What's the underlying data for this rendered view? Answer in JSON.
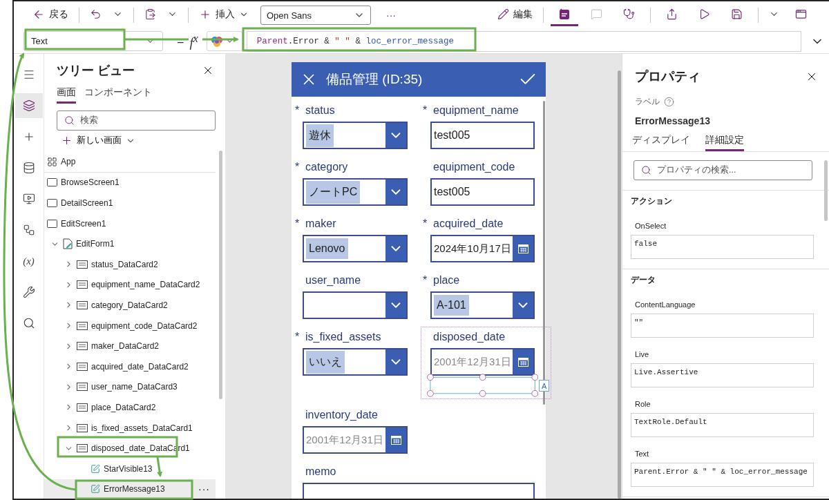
{
  "toolbar": {
    "back": {
      "label": "戻る"
    },
    "history": [
      {
        "kind": "undo"
      },
      {
        "kind": "paste"
      }
    ],
    "insert": {
      "label": "挿入"
    },
    "font": {
      "value": "Open Sans"
    },
    "more": "···",
    "edit": {
      "label": "編集"
    },
    "tools": [
      {
        "kind": "app-checker",
        "selected": true,
        "disabled": false
      },
      {
        "kind": "comment",
        "selected": false,
        "disabled": true
      },
      {
        "kind": "monitor",
        "selected": false,
        "disabled": false
      },
      {
        "kind": "share",
        "selected": false,
        "disabled": false
      },
      {
        "kind": "play",
        "selected": false,
        "disabled": false
      },
      {
        "kind": "save",
        "selected": false,
        "disabled": false
      },
      {
        "kind": "publish",
        "selected": false,
        "disabled": false
      }
    ]
  },
  "formula_bar": {
    "property": "Text",
    "equals": "=",
    "function_label": "f$^{x}$",
    "tokens": [
      {
        "text": "Parent",
        "kind": "keyword"
      },
      {
        "text": ".Error & ",
        "kind": "plain"
      },
      {
        "text": "\" \"",
        "kind": "string"
      },
      {
        "text": " & ",
        "kind": "plain"
      },
      {
        "text": "loc_error_message",
        "kind": "variable"
      }
    ]
  },
  "rail": [
    {
      "kind": "menu",
      "selected": false
    },
    {
      "kind": "tree",
      "selected": true
    },
    {
      "kind": "insert",
      "selected": false
    },
    {
      "kind": "data",
      "selected": false
    },
    {
      "kind": "media",
      "selected": false
    },
    {
      "kind": "automate",
      "selected": false
    },
    {
      "kind": "variables",
      "selected": false,
      "label": "(x)"
    },
    {
      "kind": "tools",
      "selected": false
    },
    {
      "kind": "search",
      "selected": false
    }
  ],
  "tree_view": {
    "title": "ツリー ビュー",
    "tabs": [
      {
        "label": "画面",
        "selected": true
      },
      {
        "label": "コンポーネント",
        "selected": false
      }
    ],
    "search": {
      "placeholder": "検索"
    },
    "new_screen": {
      "label": "新しい画面"
    },
    "items": [
      {
        "label": "App",
        "kind": "app",
        "selected": false
      },
      {
        "label": "BrowseScreen1",
        "kind": "screen",
        "selected": false
      },
      {
        "label": "DetailScreen1",
        "kind": "screen",
        "selected": false
      },
      {
        "label": "EditScreen1",
        "kind": "screen",
        "selected": false,
        "children": [
          {
            "label": "EditForm1",
            "kind": "form",
            "selected": false,
            "expanded": true,
            "children": [
              {
                "label": "status_DataCard2",
                "kind": "card",
                "selected": false,
                "expanded": false
              },
              {
                "label": "equipment_name_DataCard2",
                "kind": "card",
                "selected": false,
                "expanded": false
              },
              {
                "label": "category_DataCard2",
                "kind": "card",
                "selected": false,
                "expanded": false
              },
              {
                "label": "equipment_code_DataCard2",
                "kind": "card",
                "selected": false,
                "expanded": false
              },
              {
                "label": "maker_DataCard2",
                "kind": "card",
                "selected": false,
                "expanded": false
              },
              {
                "label": "acquired_date_DataCard2",
                "kind": "card",
                "selected": false,
                "expanded": false
              },
              {
                "label": "user_name_DataCard3",
                "kind": "card",
                "selected": false,
                "expanded": false
              },
              {
                "label": "place_DataCard2",
                "kind": "card",
                "selected": false,
                "expanded": false
              },
              {
                "label": "is_fixed_assets_DataCard1",
                "kind": "card",
                "selected": false,
                "expanded": false
              },
              {
                "label": "disposed_date_DataCard1",
                "kind": "card",
                "selected": false,
                "expanded": true,
                "children": [
                  {
                    "label": "StarVisible13",
                    "kind": "label",
                    "selected": false
                  },
                  {
                    "label": "ErrorMessage13",
                    "kind": "label",
                    "selected": true,
                    "more": "···"
                  }
                ]
              }
            ]
          }
        ]
      }
    ]
  },
  "form": {
    "title": "備品管理 (ID:35)",
    "fields": [
      {
        "label": "status",
        "mark": "*",
        "kind": "dropdown",
        "value": "遊休",
        "selected": false
      },
      {
        "label": "equipment_name",
        "mark": "*",
        "kind": "text",
        "value": "test005",
        "selected": false
      },
      {
        "label": "category",
        "mark": "*",
        "kind": "dropdown",
        "value": "ノートPC",
        "selected": false
      },
      {
        "label": "equipment_code",
        "kind": "text",
        "value": "test005",
        "selected": false
      },
      {
        "label": "maker",
        "mark": "*",
        "kind": "dropdown",
        "value": "Lenovo",
        "selected": false
      },
      {
        "label": "acquired_date",
        "mark": "*",
        "kind": "date",
        "value": "2024年10月17日",
        "selected": false
      },
      {
        "label": "user_name",
        "kind": "dropdown",
        "selected": false
      },
      {
        "label": "place",
        "mark": "*",
        "kind": "dropdown",
        "value": "A-101",
        "selected": false
      },
      {
        "label": "is_fixed_assets",
        "mark": "*",
        "kind": "dropdown",
        "value": "いいえ",
        "selected": false
      },
      {
        "label": "disposed_date",
        "kind": "date",
        "placeholder": "2001年12月31日",
        "selected": true,
        "badge": "A"
      },
      {
        "label": "inventory_date",
        "kind": "date",
        "placeholder": "2001年12月31日",
        "selected": false
      },
      {
        "label": "memo",
        "kind": "memo",
        "selected": false
      }
    ]
  },
  "properties": {
    "title": "プロパティ",
    "type_label": "ラベル",
    "control_name": "ErrorMessage13",
    "tabs": [
      {
        "label": "ディスプレイ",
        "selected": false
      },
      {
        "label": "詳細設定",
        "selected": true
      }
    ],
    "search": {
      "placeholder": "プロパティの検索..."
    },
    "sections": [
      {
        "title": "アクション",
        "properties": [
          {
            "name": "OnSelect",
            "value": "false"
          }
        ]
      },
      {
        "title": "データ",
        "properties": [
          {
            "name": "ContentLanguage",
            "value": "\"\""
          },
          {
            "name": "Live",
            "value": "Live.Assertive"
          },
          {
            "name": "Role",
            "value": "TextRole.Default"
          },
          {
            "name": "Text",
            "value": "Parent.Error & \" \" & loc_error_message"
          }
        ]
      }
    ]
  }
}
